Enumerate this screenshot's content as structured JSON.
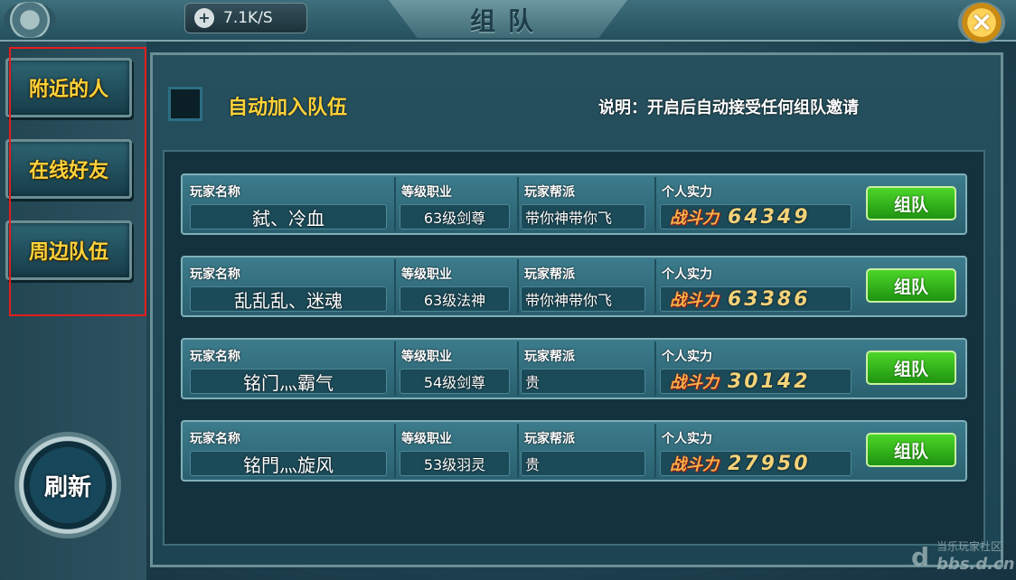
{
  "header": {
    "speed": "7.1K/S",
    "title": "组队",
    "close_symbol": "×"
  },
  "tabs": [
    {
      "label": "附近的人"
    },
    {
      "label": "在线好友"
    },
    {
      "label": "周边队伍"
    }
  ],
  "refresh_label": "刷新",
  "auto_join": {
    "label": "自动加入队伍",
    "checked": false,
    "note": "说明：开启后自动接受任何组队邀请"
  },
  "columns": {
    "name": "玩家名称",
    "level_class": "等级职业",
    "guild": "玩家帮派",
    "power": "个人实力"
  },
  "power_prefix": "战斗力",
  "players": [
    {
      "name": "弑、冷血",
      "level_class": "63级剑尊",
      "guild": "带你神带你飞",
      "power": "64349",
      "button": "组队"
    },
    {
      "name": "乱乱乱、迷魂",
      "level_class": "63级法神",
      "guild": "带你神带你飞",
      "power": "63386",
      "button": "组队"
    },
    {
      "name": "铭门灬霸气",
      "level_class": "54级剑尊",
      "guild": "贵",
      "power": "30142",
      "button": "组队"
    },
    {
      "name": "铭門灬旋风",
      "level_class": "53级羽灵",
      "guild": "贵",
      "power": "27950",
      "button": "组队"
    }
  ],
  "watermark": {
    "line1": "当乐玩家社区",
    "line2": "bbs.d.cn",
    "logo": "d"
  }
}
